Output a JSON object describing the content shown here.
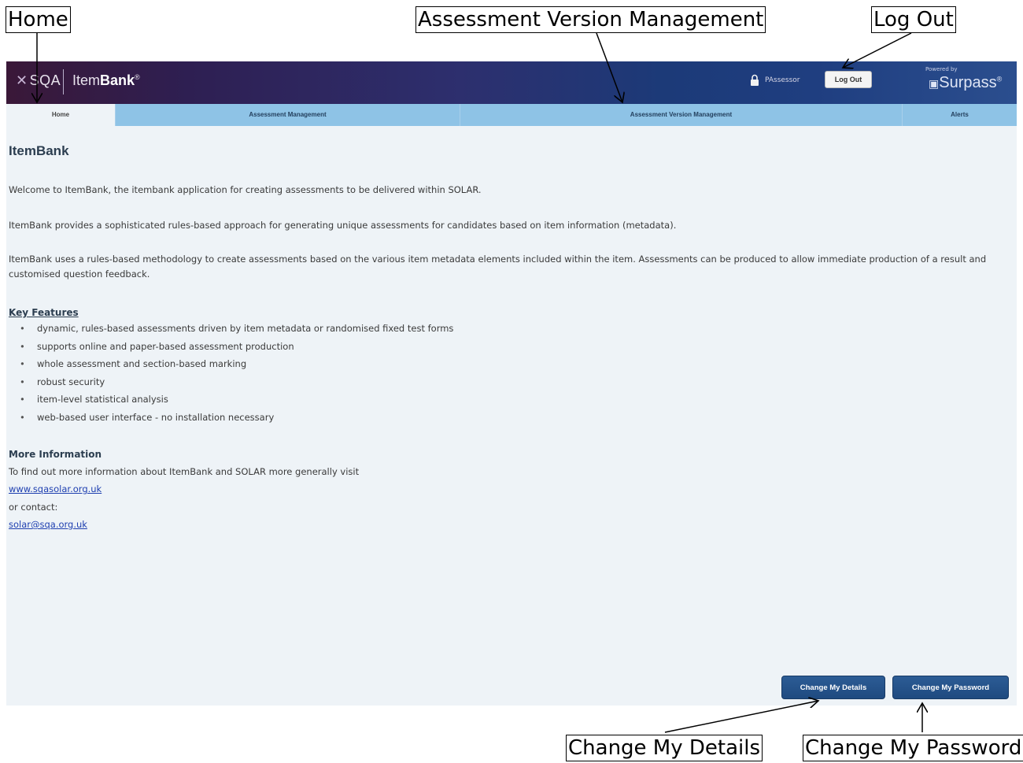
{
  "callouts": {
    "home": "Home",
    "avm": "Assessment Version Management",
    "logout": "Log Out",
    "change_details": "Change My Details",
    "change_password": "Change My Password"
  },
  "header": {
    "sqa_logo": "SQA",
    "itembank_prefix": "Item",
    "itembank_bold": "Bank",
    "itembank_mark": "®",
    "username": "PAssessor",
    "logout_label": "Log Out",
    "powered_by": "Powered by",
    "surpass": "Surpass",
    "surpass_mark": "®"
  },
  "tabs": [
    "Home",
    "Assessment Management",
    "Assessment Version Management",
    "Alerts"
  ],
  "main": {
    "title": "ItemBank",
    "p1": "Welcome to ItemBank, the itembank application for creating assessments to be delivered within SOLAR.",
    "p2": "ItemBank provides a sophisticated rules-based approach for generating unique assessments for candidates based on item information (metadata).",
    "p3": "ItemBank uses a rules-based methodology to create assessments based on the various item metadata elements included within the item. Assessments can be produced to allow immediate production of a result and customised question feedback.",
    "key_features_heading": "Key Features",
    "features": [
      "dynamic, rules-based assessments driven by item metadata or randomised fixed test forms",
      "supports online and paper-based assessment production",
      "whole assessment and section-based marking",
      "robust security",
      "item-level statistical analysis",
      "web-based user interface - no installation necessary"
    ],
    "more_info_heading": "More Information",
    "more_info_text": "To find out more information about ItemBank and SOLAR more generally visit",
    "website": "www.sqasolar.org.uk",
    "or_contact": "or contact:",
    "email": "solar@sqa.org.uk"
  },
  "buttons": {
    "change_details": "Change My Details",
    "change_password": "Change My Password"
  },
  "colors": {
    "header_dark": "#2e1f52",
    "tab_bar": "#8ec3e6",
    "content_bg": "#eef3f7",
    "button_blue": "#1f4a80",
    "link": "#1e3fb0"
  }
}
